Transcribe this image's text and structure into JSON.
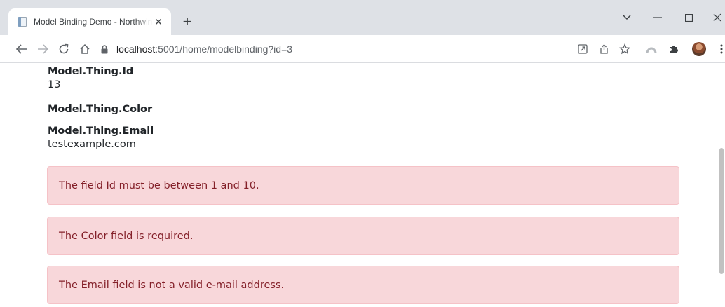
{
  "browser": {
    "tab_title": "Model Binding Demo - Northwind",
    "tab_close": "✕",
    "new_tab": "+",
    "url_host": "localhost",
    "url_rest": ":5001/home/modelbinding?id=3"
  },
  "model": {
    "id_label": "Model.Thing.Id",
    "id_value": "13",
    "color_label": "Model.Thing.Color",
    "email_label": "Model.Thing.Email",
    "email_value": "testexample.com"
  },
  "errors": [
    "The field Id must be between 1 and 10.",
    "The Color field is required.",
    "The Email field is not a valid e-mail address."
  ],
  "colors": {
    "alert_bg": "#f8d7da",
    "alert_border": "#f5c2c7",
    "alert_text": "#842029",
    "tabstrip_bg": "#dee1e6"
  }
}
